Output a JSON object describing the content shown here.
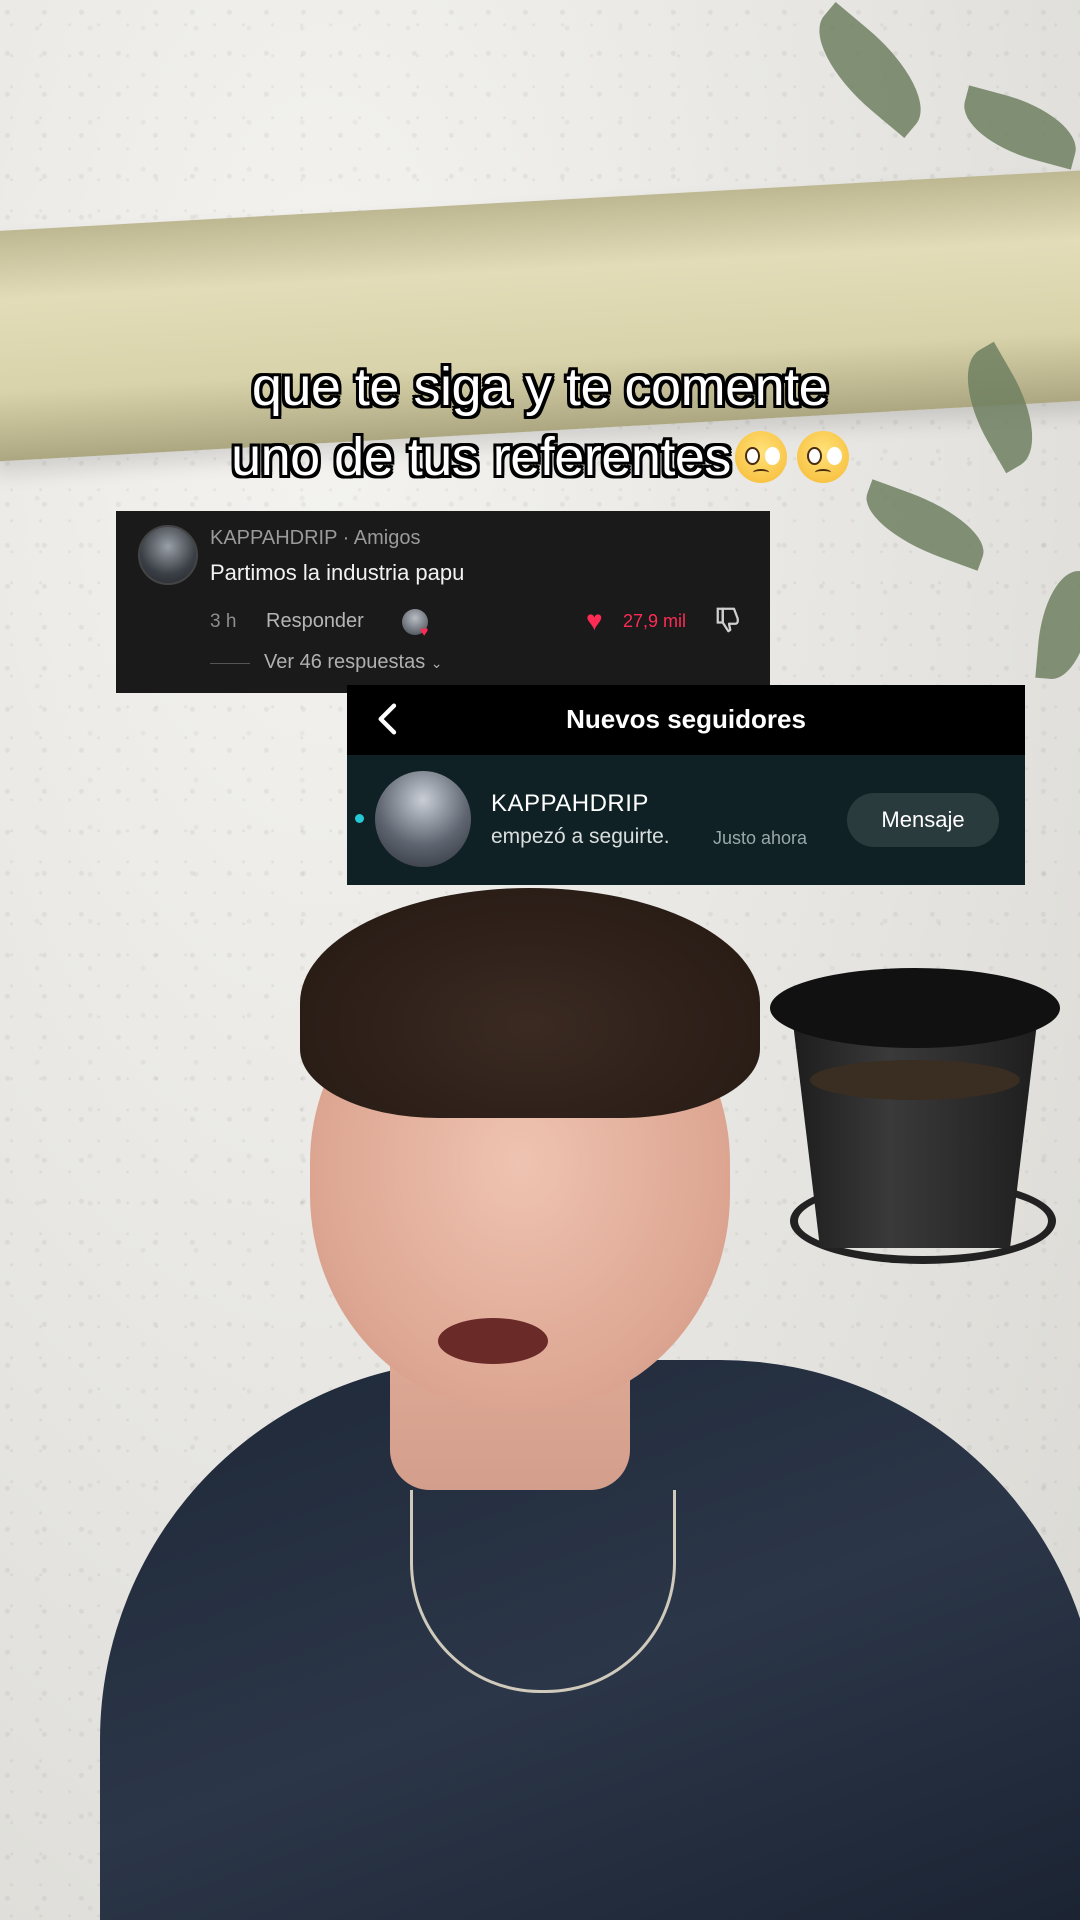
{
  "caption": {
    "line1": "que te siga y te comente",
    "line2": "uno de tus referentes"
  },
  "comment": {
    "username": "KAPPAHDRIP",
    "separator": " · ",
    "relation": "Amigos",
    "text": "Partimos la industria papu",
    "time": "3 h",
    "reply_label": "Responder",
    "like_count": "27,9 mil",
    "view_replies": "Ver 46 respuestas",
    "icons": {
      "like": "heart-icon",
      "dislike": "thumbs-down-icon",
      "expand": "chevron-down-icon"
    }
  },
  "followers": {
    "title": "Nuevos seguidores",
    "name": "KAPPAHDRIP",
    "action": "empezó a seguirte.",
    "time": "Justo ahora",
    "message_button": "Mensaje",
    "unread_color": "#25c8d6"
  },
  "colors": {
    "like_red": "#fe2c55"
  }
}
